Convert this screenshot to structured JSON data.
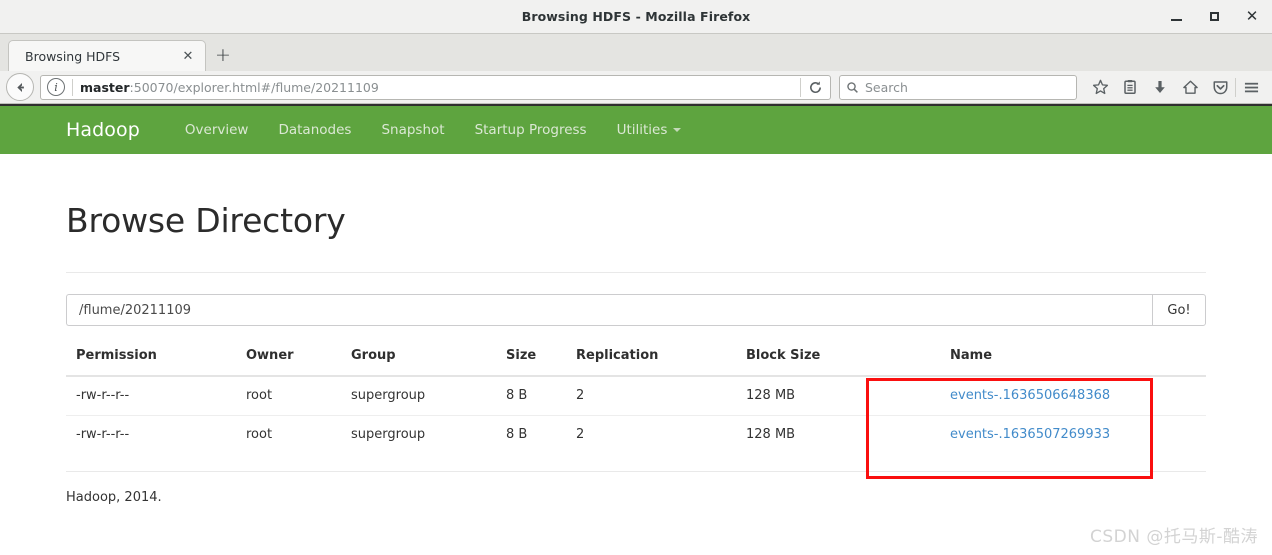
{
  "window": {
    "title": "Browsing HDFS - Mozilla Firefox",
    "controls": {
      "minimize": "–",
      "maximize": "□",
      "close": "✕"
    }
  },
  "tabs": [
    {
      "label": "Browsing HDFS",
      "close": "✕"
    }
  ],
  "newtab_label": "+",
  "urlbar": {
    "host": "master",
    "rest": ":50070/explorer.html#/flume/20211109",
    "info_icon": "i"
  },
  "search": {
    "placeholder": "Search"
  },
  "toolbar_icons": [
    {
      "name": "bookmark-star-icon"
    },
    {
      "name": "library-icon"
    },
    {
      "name": "downloads-icon"
    },
    {
      "name": "home-icon"
    },
    {
      "name": "pocket-icon"
    },
    {
      "name": "menu-hamburger-icon"
    }
  ],
  "hadoop_nav": {
    "brand": "Hadoop",
    "accent_color": "#5EA43F",
    "items": [
      {
        "label": "Overview",
        "dropdown": false
      },
      {
        "label": "Datanodes",
        "dropdown": false
      },
      {
        "label": "Snapshot",
        "dropdown": false
      },
      {
        "label": "Startup Progress",
        "dropdown": false
      },
      {
        "label": "Utilities",
        "dropdown": true
      }
    ]
  },
  "main": {
    "title": "Browse Directory",
    "path_value": "/flume/20211109",
    "go_label": "Go!",
    "table": {
      "headers": [
        "Permission",
        "Owner",
        "Group",
        "Size",
        "Replication",
        "Block Size",
        "Name"
      ],
      "rows": [
        {
          "permission": "-rw-r--r--",
          "owner": "root",
          "group": "supergroup",
          "size": "8 B",
          "replication": "2",
          "block_size": "128 MB",
          "name": "events-.1636506648368"
        },
        {
          "permission": "-rw-r--r--",
          "owner": "root",
          "group": "supergroup",
          "size": "8 B",
          "replication": "2",
          "block_size": "128 MB",
          "name": "events-.1636507269933"
        }
      ]
    },
    "highlight_color": "#fa0f0f"
  },
  "footer": {
    "text": "Hadoop, 2014."
  },
  "watermark": {
    "text": "CSDN @托马斯-酷涛"
  }
}
